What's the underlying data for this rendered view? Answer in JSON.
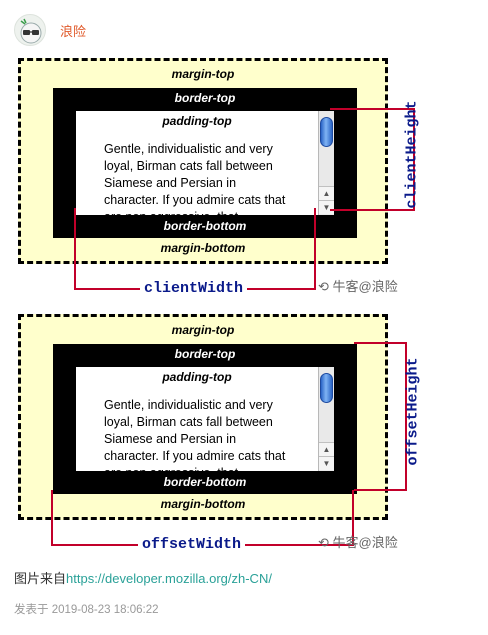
{
  "author": {
    "name": "浪险",
    "avatar_icon": "avatar-glasses-icon"
  },
  "diagram1": {
    "margin_top": "margin-top",
    "border_top": "border-top",
    "padding_top": "padding-top",
    "border_bottom": "border-bottom",
    "margin_bottom": "margin-bottom",
    "text": "Gentle, individualistic and very loyal, Birman cats fall between Siamese and Persian in character. If you admire cats that are non aggressive, that",
    "height_label": "clientHeight",
    "width_label": "clientWidth",
    "watermark": "牛客@浪险"
  },
  "diagram2": {
    "margin_top": "margin-top",
    "border_top": "border-top",
    "padding_top": "padding-top",
    "border_bottom": "border-bottom",
    "margin_bottom": "margin-bottom",
    "text": "Gentle, individualistic and very loyal, Birman cats fall between Siamese and Persian in character. If you admire cats that are non aggressive, that",
    "height_label": "offsetHeight",
    "width_label": "offsetWidth",
    "watermark": "牛客@浪险"
  },
  "caption": {
    "prefix": "图片来自",
    "link": "https://developer.mozilla.org/zh-CN/"
  },
  "meta": {
    "published": "发表于 2019-08-23 18:06:22"
  },
  "colors": {
    "measure_line": "#c2002a",
    "measure_text": "#0a1a8a",
    "margin_fill": "#ffffcc",
    "author": "#e05a2b",
    "link": "#2aa198"
  }
}
